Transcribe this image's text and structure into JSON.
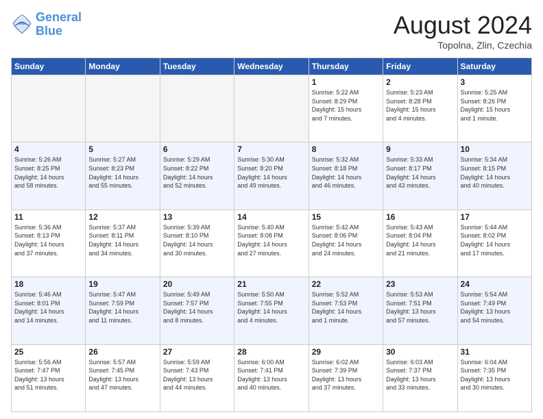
{
  "header": {
    "logo_line1": "General",
    "logo_line2": "Blue",
    "month_title": "August 2024",
    "subtitle": "Topolna, Zlin, Czechia"
  },
  "weekdays": [
    "Sunday",
    "Monday",
    "Tuesday",
    "Wednesday",
    "Thursday",
    "Friday",
    "Saturday"
  ],
  "weeks": [
    [
      {
        "day": "",
        "info": ""
      },
      {
        "day": "",
        "info": ""
      },
      {
        "day": "",
        "info": ""
      },
      {
        "day": "",
        "info": ""
      },
      {
        "day": "1",
        "info": "Sunrise: 5:22 AM\nSunset: 8:29 PM\nDaylight: 15 hours\nand 7 minutes."
      },
      {
        "day": "2",
        "info": "Sunrise: 5:23 AM\nSunset: 8:28 PM\nDaylight: 15 hours\nand 4 minutes."
      },
      {
        "day": "3",
        "info": "Sunrise: 5:25 AM\nSunset: 8:26 PM\nDaylight: 15 hours\nand 1 minute."
      }
    ],
    [
      {
        "day": "4",
        "info": "Sunrise: 5:26 AM\nSunset: 8:25 PM\nDaylight: 14 hours\nand 58 minutes."
      },
      {
        "day": "5",
        "info": "Sunrise: 5:27 AM\nSunset: 8:23 PM\nDaylight: 14 hours\nand 55 minutes."
      },
      {
        "day": "6",
        "info": "Sunrise: 5:29 AM\nSunset: 8:22 PM\nDaylight: 14 hours\nand 52 minutes."
      },
      {
        "day": "7",
        "info": "Sunrise: 5:30 AM\nSunset: 8:20 PM\nDaylight: 14 hours\nand 49 minutes."
      },
      {
        "day": "8",
        "info": "Sunrise: 5:32 AM\nSunset: 8:18 PM\nDaylight: 14 hours\nand 46 minutes."
      },
      {
        "day": "9",
        "info": "Sunrise: 5:33 AM\nSunset: 8:17 PM\nDaylight: 14 hours\nand 43 minutes."
      },
      {
        "day": "10",
        "info": "Sunrise: 5:34 AM\nSunset: 8:15 PM\nDaylight: 14 hours\nand 40 minutes."
      }
    ],
    [
      {
        "day": "11",
        "info": "Sunrise: 5:36 AM\nSunset: 8:13 PM\nDaylight: 14 hours\nand 37 minutes."
      },
      {
        "day": "12",
        "info": "Sunrise: 5:37 AM\nSunset: 8:11 PM\nDaylight: 14 hours\nand 34 minutes."
      },
      {
        "day": "13",
        "info": "Sunrise: 5:39 AM\nSunset: 8:10 PM\nDaylight: 14 hours\nand 30 minutes."
      },
      {
        "day": "14",
        "info": "Sunrise: 5:40 AM\nSunset: 8:08 PM\nDaylight: 14 hours\nand 27 minutes."
      },
      {
        "day": "15",
        "info": "Sunrise: 5:42 AM\nSunset: 8:06 PM\nDaylight: 14 hours\nand 24 minutes."
      },
      {
        "day": "16",
        "info": "Sunrise: 5:43 AM\nSunset: 8:04 PM\nDaylight: 14 hours\nand 21 minutes."
      },
      {
        "day": "17",
        "info": "Sunrise: 5:44 AM\nSunset: 8:02 PM\nDaylight: 14 hours\nand 17 minutes."
      }
    ],
    [
      {
        "day": "18",
        "info": "Sunrise: 5:46 AM\nSunset: 8:01 PM\nDaylight: 14 hours\nand 14 minutes."
      },
      {
        "day": "19",
        "info": "Sunrise: 5:47 AM\nSunset: 7:59 PM\nDaylight: 14 hours\nand 11 minutes."
      },
      {
        "day": "20",
        "info": "Sunrise: 5:49 AM\nSunset: 7:57 PM\nDaylight: 14 hours\nand 8 minutes."
      },
      {
        "day": "21",
        "info": "Sunrise: 5:50 AM\nSunset: 7:55 PM\nDaylight: 14 hours\nand 4 minutes."
      },
      {
        "day": "22",
        "info": "Sunrise: 5:52 AM\nSunset: 7:53 PM\nDaylight: 14 hours\nand 1 minute."
      },
      {
        "day": "23",
        "info": "Sunrise: 5:53 AM\nSunset: 7:51 PM\nDaylight: 13 hours\nand 57 minutes."
      },
      {
        "day": "24",
        "info": "Sunrise: 5:54 AM\nSunset: 7:49 PM\nDaylight: 13 hours\nand 54 minutes."
      }
    ],
    [
      {
        "day": "25",
        "info": "Sunrise: 5:56 AM\nSunset: 7:47 PM\nDaylight: 13 hours\nand 51 minutes."
      },
      {
        "day": "26",
        "info": "Sunrise: 5:57 AM\nSunset: 7:45 PM\nDaylight: 13 hours\nand 47 minutes."
      },
      {
        "day": "27",
        "info": "Sunrise: 5:59 AM\nSunset: 7:43 PM\nDaylight: 13 hours\nand 44 minutes."
      },
      {
        "day": "28",
        "info": "Sunrise: 6:00 AM\nSunset: 7:41 PM\nDaylight: 13 hours\nand 40 minutes."
      },
      {
        "day": "29",
        "info": "Sunrise: 6:02 AM\nSunset: 7:39 PM\nDaylight: 13 hours\nand 37 minutes."
      },
      {
        "day": "30",
        "info": "Sunrise: 6:03 AM\nSunset: 7:37 PM\nDaylight: 13 hours\nand 33 minutes."
      },
      {
        "day": "31",
        "info": "Sunrise: 6:04 AM\nSunset: 7:35 PM\nDaylight: 13 hours\nand 30 minutes."
      }
    ]
  ]
}
